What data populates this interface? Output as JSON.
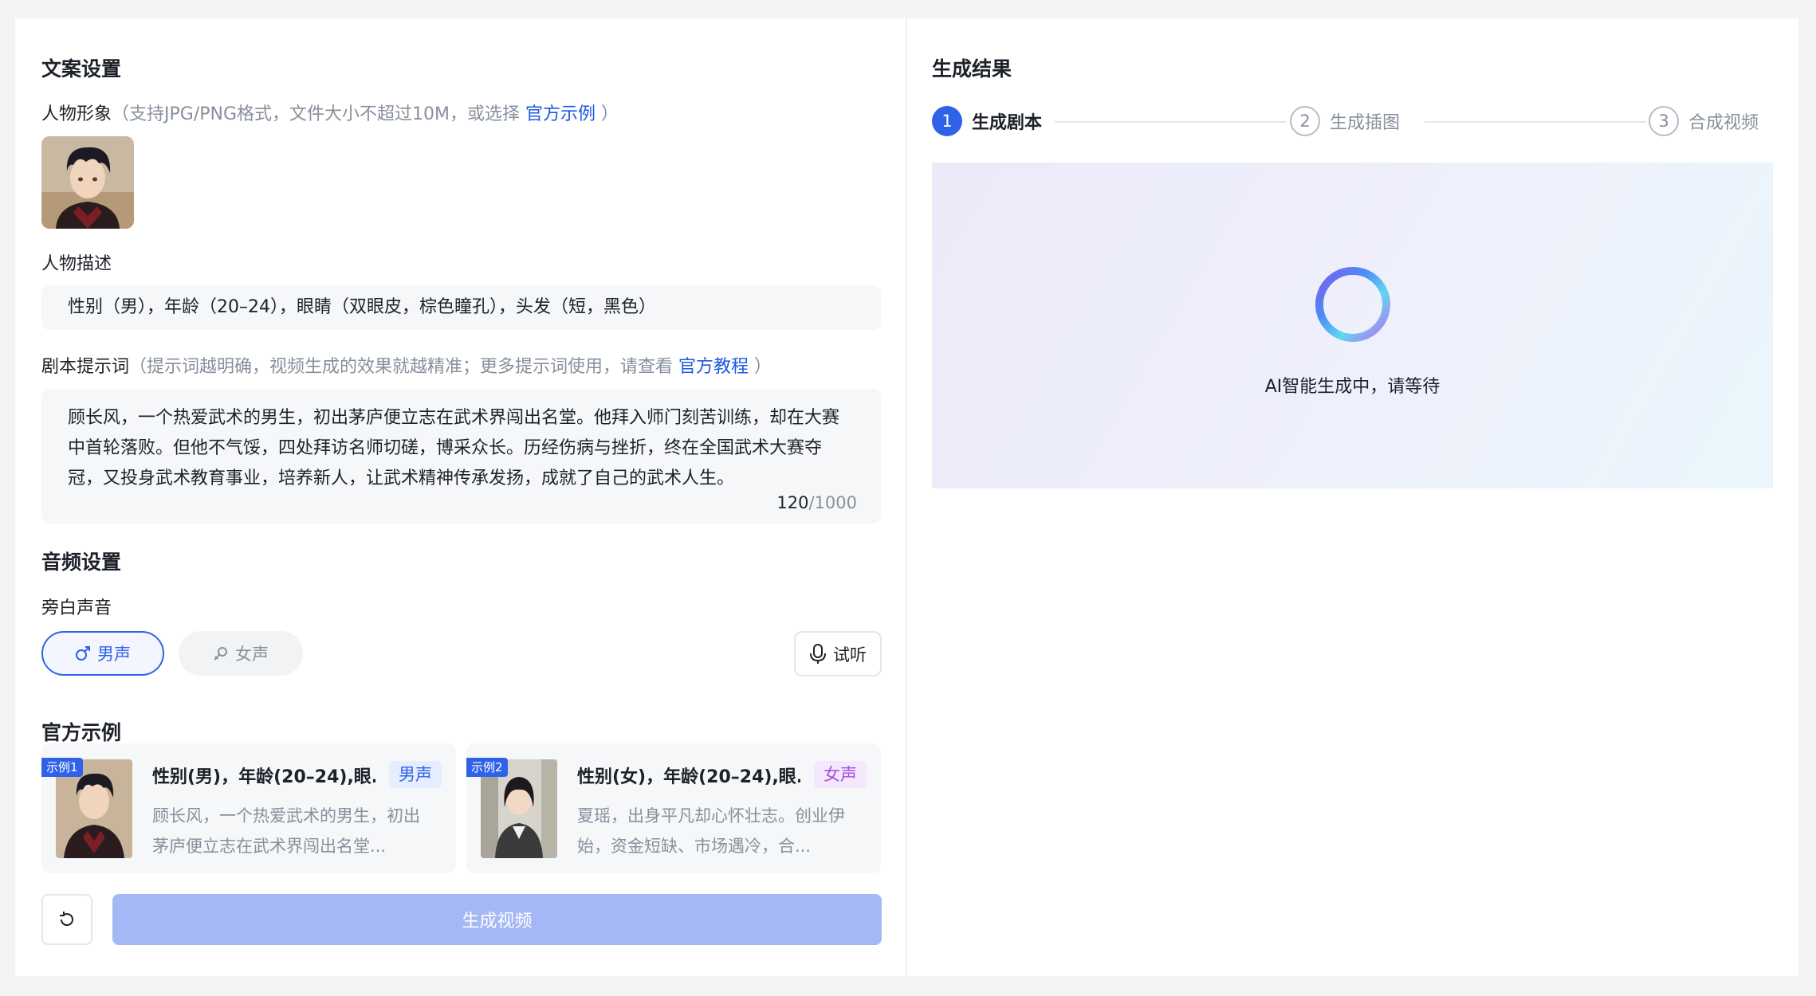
{
  "left": {
    "copy_section_title": "文案设置",
    "character_image": {
      "label": "人物形象",
      "hint": "（支持JPG/PNG格式，文件大小不超过10M，或选择",
      "link": "官方示例",
      "hint_end": "）"
    },
    "character_desc": {
      "label": "人物描述",
      "value": "性别（男），年龄（20–24），眼睛（双眼皮，棕色瞳孔），头发（短，黑色）"
    },
    "script_prompt": {
      "label": "剧本提示词",
      "hint": "（提示词越明确，视频生成的效果就越精准；更多提示词使用，请查看",
      "link": "官方教程",
      "hint_end": "）",
      "value": "顾长风，一个热爱武术的男生，初出茅庐便立志在武术界闯出名堂。他拜入师门刻苦训练，却在大赛中首轮落败。但他不气馁，四处拜访名师切磋，博采众长。历经伤病与挫折，终在全国武术大赛夺冠，又投身武术教育事业，培养新人，让武术精神传承发扬，成就了自己的武术人生。",
      "count": "120",
      "max": "/1000"
    },
    "audio_section_title": "音频设置",
    "narration_label": "旁白声音",
    "voice_male": "男声",
    "voice_female": "女声",
    "listen": "试听",
    "examples_title": "官方示例",
    "examples": [
      {
        "tag": "示例1",
        "title": "性别(男)，年龄(20–24),眼...",
        "badge": "男声",
        "desc": "顾长风，一个热爱武术的男生，初出茅庐便立志在武术界闯出名堂..."
      },
      {
        "tag": "示例2",
        "title": "性别(女)，年龄(20–24),眼...",
        "badge": "女声",
        "desc": "夏瑶，出身平凡却心怀壮志。创业伊始，资金短缺、市场遇冷，合..."
      }
    ],
    "generate_button": "生成视频"
  },
  "right": {
    "title": "生成结果",
    "steps": [
      {
        "num": "1",
        "label": "生成剧本"
      },
      {
        "num": "2",
        "label": "生成插图"
      },
      {
        "num": "3",
        "label": "合成视频"
      }
    ],
    "loading_text": "AI智能生成中，请等待"
  },
  "colors": {
    "accent": "#2f62e8",
    "link": "#1d5ae0",
    "disabled_button": "#a4b8f5"
  }
}
